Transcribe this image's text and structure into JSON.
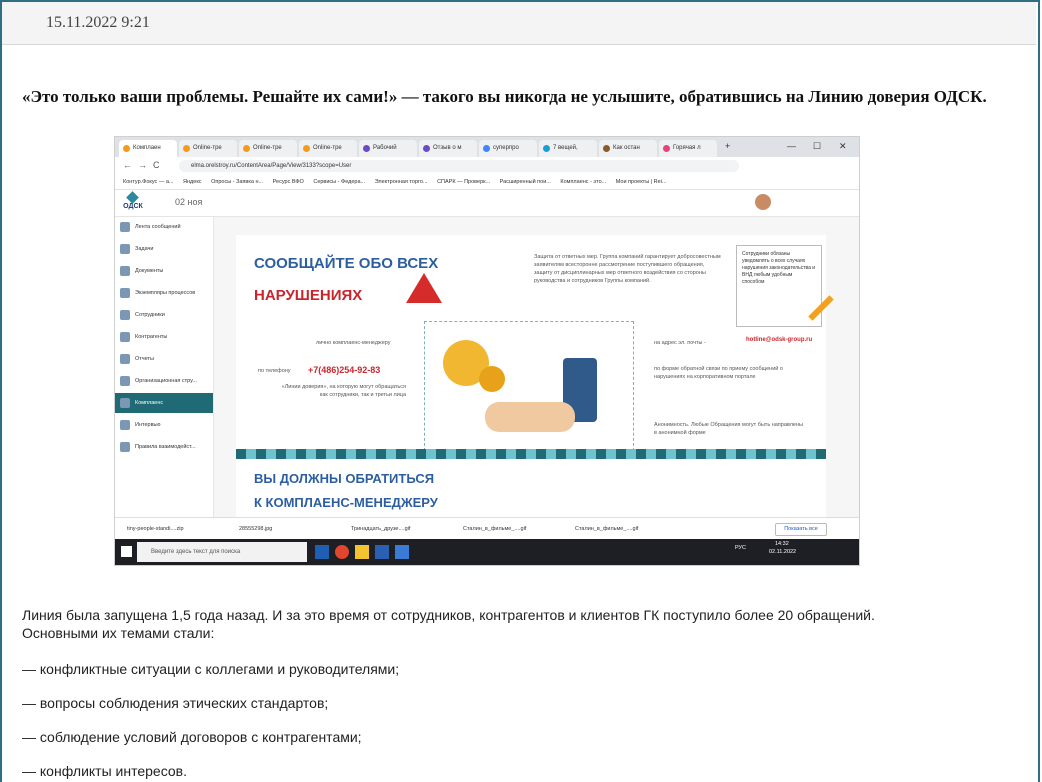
{
  "post": {
    "date": "15.11.2022 9:21",
    "headline": "«Это только ваши проблемы. Решайте их сами!» — такого вы никогда не услышите, обратившись на Линию доверия ОДСК.",
    "paragraph_1": "Линия была запущена 1,5 года назад. И за это время от сотрудников, контрагентов и клиентов ГК поступило более 20 обращений.",
    "paragraph_2": "Основными их темами стали:",
    "list": [
      "— конфликтные ситуации с коллегами и руководителями;",
      "— вопросы соблюдения этических стандартов;",
      "— соблюдение условий договоров с контрагентами;",
      "— конфликты интересов."
    ]
  },
  "screenshot": {
    "tabs": [
      "Комплаен",
      "Online-тре",
      "Online-тре",
      "Online-тре",
      "Рабочий",
      "Отзыв о м",
      "суперпро",
      "7 вещей,",
      "Как остан",
      "Горячая л"
    ],
    "url": "elma.orelstroy.ru/ContentArea/Page/View/3133?scope=User",
    "bookmarks": [
      "Контур.Фокус — а...",
      "Яндекс",
      "Опросы - Заявка н...",
      "Ресурс ВФО",
      "Сервисы - Федера...",
      "Электронная торго...",
      "СПАРК — Проверк...",
      "Расширенный пои...",
      "Комплаенс - это...",
      "Мои проекты | Rei..."
    ],
    "logo": "ОДСК",
    "app_date": "02 ноя",
    "sidebar": [
      "Лента сообщений",
      "Задачи",
      "Документы",
      "Экземпляры процессов",
      "Сотрудники",
      "Контрагенты",
      "Отчеты",
      "Организационная стру...",
      "Комплаенс",
      "Интервью",
      "Правила взаимодейст..."
    ],
    "active_sidebar": 8,
    "banner": {
      "title_1": "СООБЩАЙТЕ ОБО ВСЕХ",
      "title_2": "НАРУШЕНИЯХ",
      "protection": "Защита от ответных мер. Группа компаний гарантирует добросовестным заявителям всесторонне рассмотрение поступившего обращения, защиту от дисциплинарных мер ответного воздействия со стороны руководства и сотрудников Группы компаний.",
      "personally": "лично комплаенс-менеджеру",
      "by_phone": "по телефону",
      "phone": "+7(486)254-92-83",
      "line_text": "«Линии доверия», на которую могут обращаться как сотрудники, так и третьи лица",
      "email_label": "на адрес эл. почты -",
      "email": "hotline@odsk-group.ru",
      "form_text": "по форме обратной связи по приему сообщений о нарушениях на корпоративном портале",
      "anon": "Анонимность. Любые Обращения могут быть направлены в анонимной форме",
      "note": "Сотрудники обязаны уведомлять о всех случаях нарушения законодательства и ВНД любым удобным способом"
    },
    "banner2": {
      "title_1": "ВЫ ДОЛЖНЫ ОБРАТИТЬСЯ",
      "title_2": "К КОМПЛАЕНС-МЕНЕДЖЕРУ"
    },
    "downloads": [
      "tiny-people-standi....zip",
      "28555298.jpg",
      "Тринадцать_друзе....gif",
      "Сталин_в_фильме_....gif",
      "Сталин_в_фильме_....gif"
    ],
    "show_all": "Показать все",
    "taskbar_search": "Введите здесь текст для поиска",
    "tray_lang": "РУС",
    "tray_time": "14:32",
    "tray_date": "02.11.2022"
  }
}
